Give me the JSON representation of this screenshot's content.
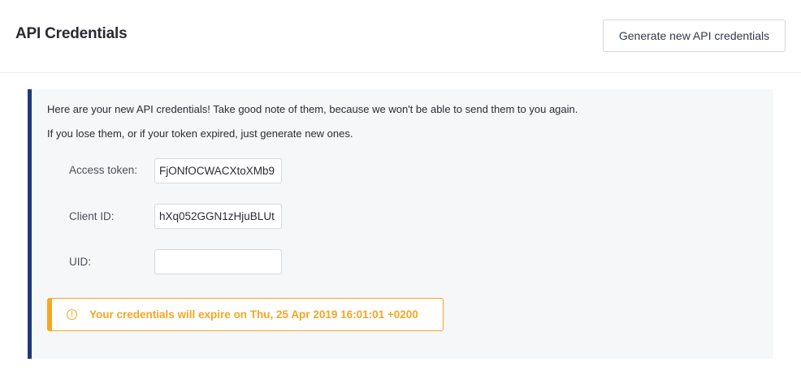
{
  "header": {
    "title": "API Credentials",
    "generate_button_label": "Generate new API credentials"
  },
  "notice": {
    "line1": "Here are your new API credentials! Take good note of them, because we won't be able to send them to you again.",
    "line2": "If you lose them, or if your token expired, just generate new ones."
  },
  "fields": {
    "access_token": {
      "label": "Access token:",
      "value": "FjONfOCWACXtoXMb9"
    },
    "client_id": {
      "label": "Client ID:",
      "value": "hXq052GGN1zHjuBLUt"
    },
    "uid": {
      "label": "UID:",
      "value": ""
    }
  },
  "warning": {
    "icon": "exclamation-circle-icon",
    "text": "Your credentials will expire on Thu, 25 Apr 2019 16:01:01 +0200",
    "color": "#f5a623"
  },
  "colors": {
    "accent_bar": "#1f3a7a",
    "panel_bg": "#f6f7f9"
  }
}
